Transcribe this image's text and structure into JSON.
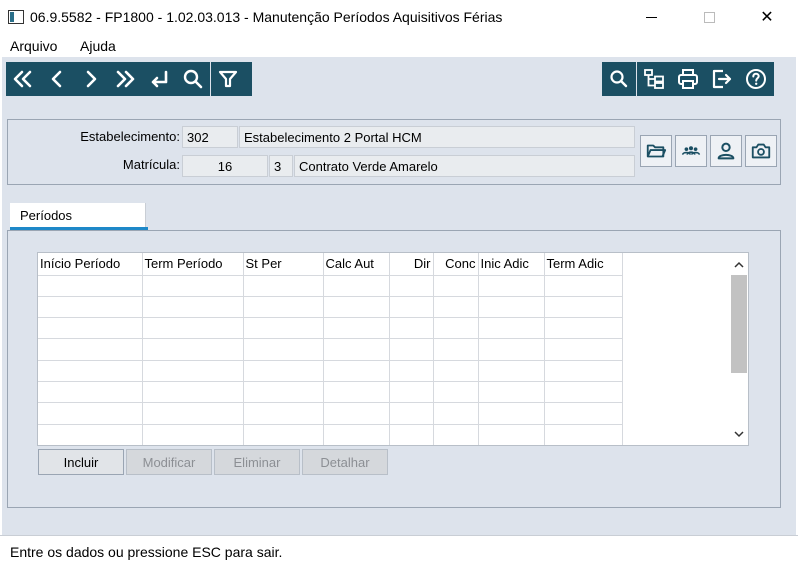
{
  "window": {
    "title": "06.9.5582 - FP1800 - 1.02.03.013 - Manutenção Períodos Aquisitivos Férias",
    "close_glyph": "✕"
  },
  "menu": {
    "items": [
      "Arquivo",
      "Ajuda"
    ]
  },
  "toolbar": {
    "left_icons": [
      "first-icon",
      "previous-icon",
      "next-icon",
      "last-icon",
      "goto-icon",
      "search-icon",
      "filter-icon"
    ],
    "right_icons": [
      "search-icon",
      "hierarchy-icon",
      "print-icon",
      "exit-icon",
      "help-icon"
    ],
    "accent_color": "#1b4f63"
  },
  "header": {
    "estabelecimento_label": "Estabelecimento:",
    "estabelecimento_code": "302",
    "estabelecimento_name": "Estabelecimento 2 Portal HCM",
    "matricula_label": "Matrícula:",
    "matricula_value": "16",
    "contrato_code": "3",
    "contrato_name": "Contrato Verde Amarelo",
    "buttons": [
      "folder-icon",
      "group-icon",
      "person-icon",
      "camera-icon"
    ]
  },
  "tabs": [
    {
      "label": "Períodos",
      "active": true
    }
  ],
  "grid": {
    "columns": [
      "Início Período",
      "Term Período",
      "St Per",
      "Calc Aut",
      "Dir",
      "Conc",
      "Inic Adic",
      "Term Adic"
    ],
    "rows": []
  },
  "actions": {
    "incluir": "Incluir",
    "modificar": "Modificar",
    "eliminar": "Eliminar",
    "detalhar": "Detalhar"
  },
  "status": {
    "text": "Entre os dados ou pressione ESC para sair."
  }
}
